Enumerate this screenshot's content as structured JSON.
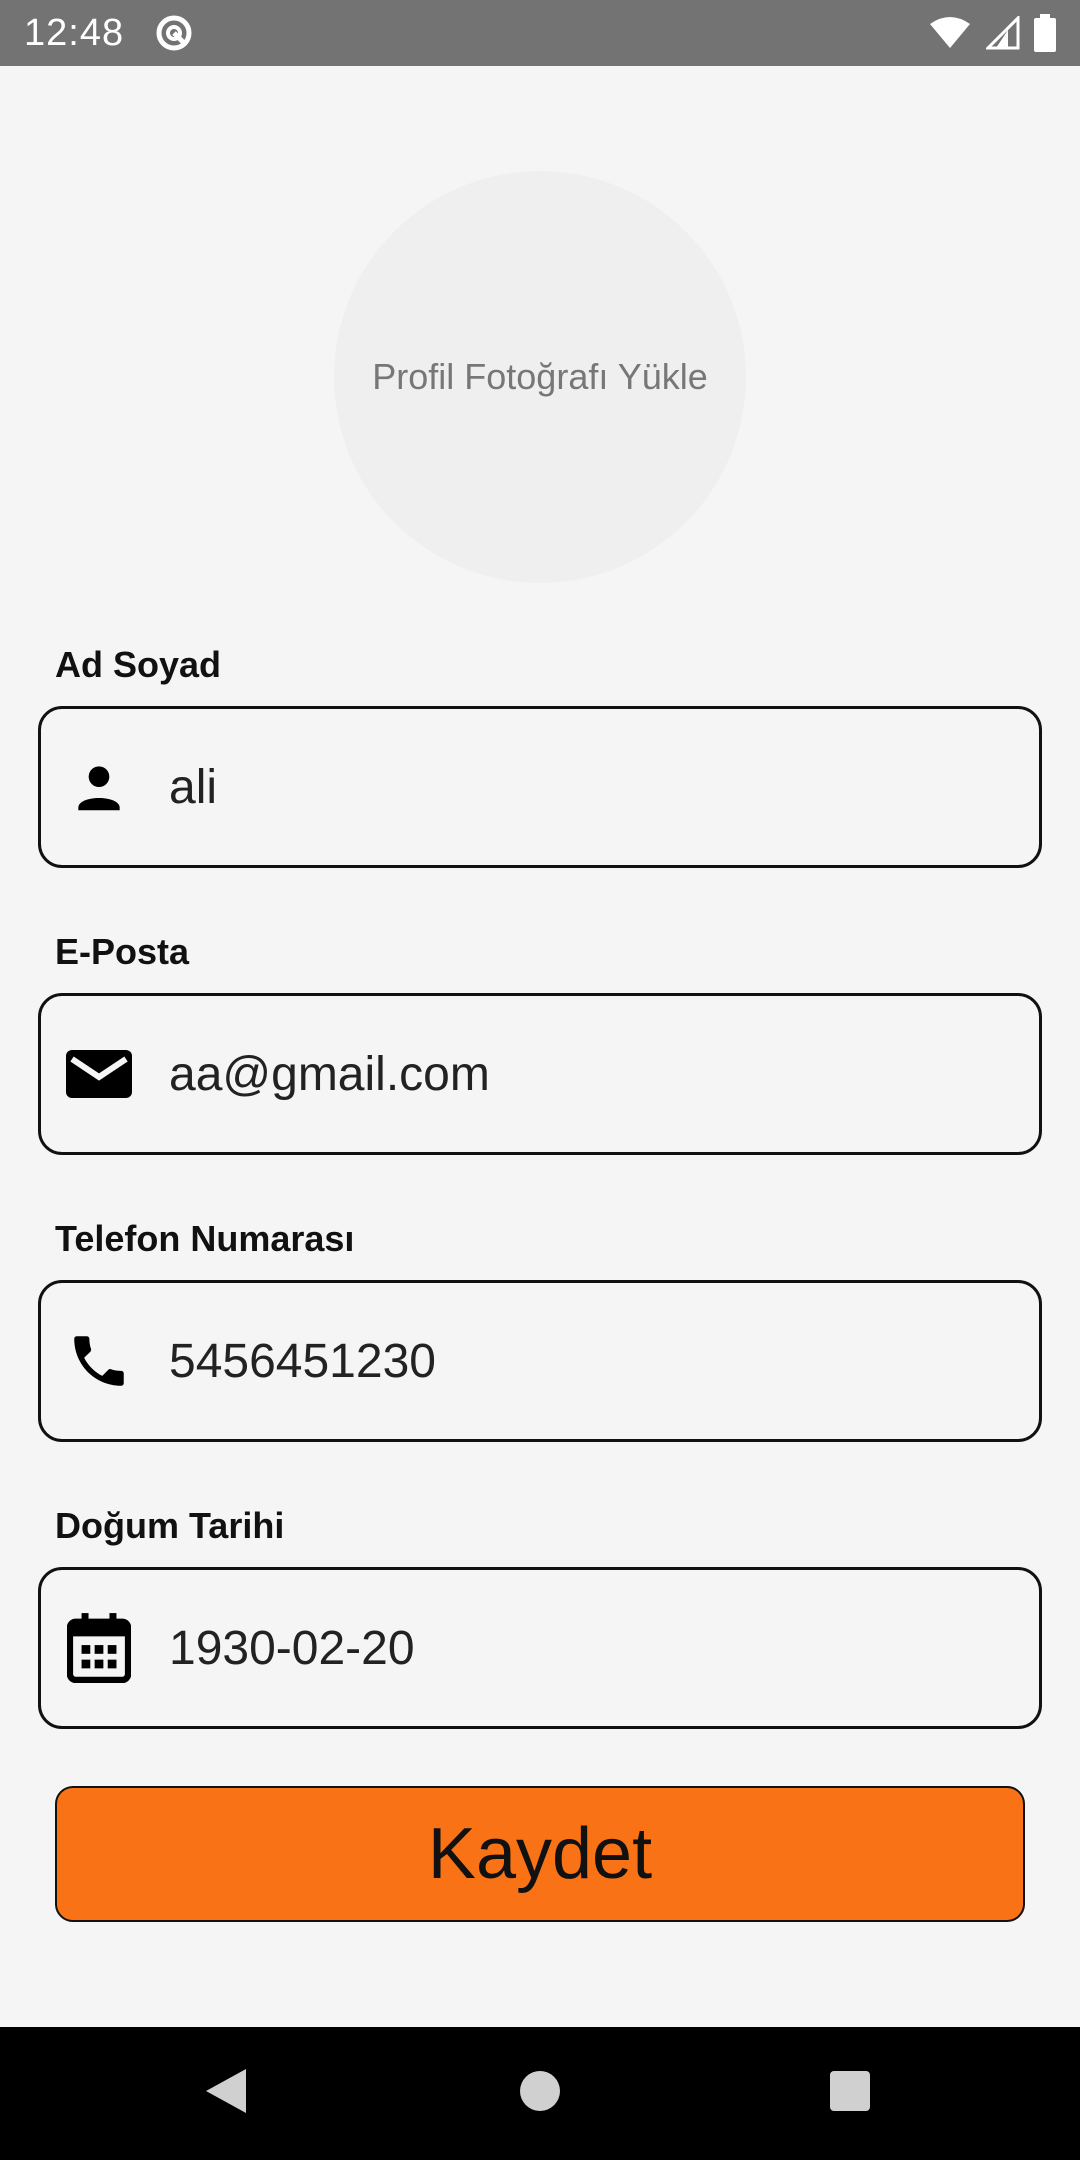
{
  "status_bar": {
    "time": "12:48",
    "icons": [
      "at-sign-icon",
      "wifi-icon",
      "signal-icon",
      "battery-icon"
    ]
  },
  "profile": {
    "upload_label": "Profil Fotoğrafı Yükle"
  },
  "form": {
    "name": {
      "label": "Ad Soyad",
      "value": "ali",
      "icon": "person-icon"
    },
    "email": {
      "label": "E-Posta",
      "value": "aa@gmail.com",
      "icon": "mail-icon"
    },
    "phone": {
      "label": "Telefon Numarası",
      "value": "5456451230",
      "icon": "phone-icon"
    },
    "birthdate": {
      "label": "Doğum Tarihi",
      "value": "1930-02-20",
      "icon": "calendar-icon"
    }
  },
  "save_button": {
    "label": "Kaydet",
    "color": "#f97316"
  },
  "nav_bar": {
    "icons": [
      "back-icon",
      "home-icon",
      "recents-icon"
    ]
  }
}
